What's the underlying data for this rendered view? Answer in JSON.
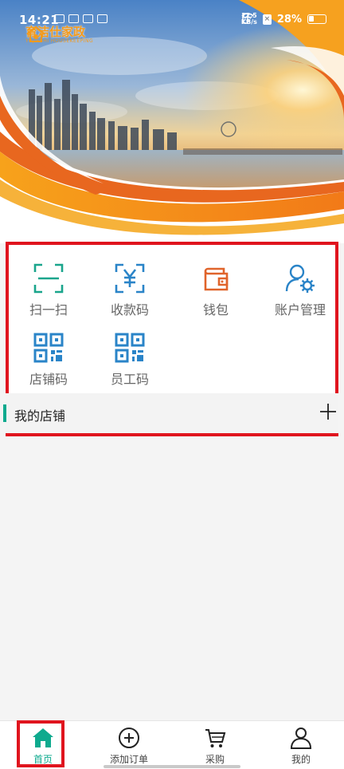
{
  "status_bar": {
    "time": "14:21",
    "net_speed_value": "12.5",
    "net_speed_unit": "KB/s",
    "battery": "28%"
  },
  "banner": {
    "logo_text": "育洁仕家政",
    "logo_sub": "YUJIESHI HOUSEKEEPING"
  },
  "quick_menu": {
    "items": [
      {
        "label": "扫一扫",
        "icon": "scan-icon",
        "color": "#1aa58c"
      },
      {
        "label": "收款码",
        "icon": "yuan-qr-icon",
        "color": "#2a84c8"
      },
      {
        "label": "钱包",
        "icon": "wallet-icon",
        "color": "#e0642b"
      },
      {
        "label": "账户管理",
        "icon": "user-settings-icon",
        "color": "#2a84c8"
      },
      {
        "label": "店铺码",
        "icon": "qr-code-icon",
        "color": "#2a84c8"
      },
      {
        "label": "员工码",
        "icon": "qr-code-icon",
        "color": "#2a84c8"
      }
    ]
  },
  "my_shop": {
    "title": "我的店铺"
  },
  "bottom_nav": {
    "items": [
      {
        "label": "首页",
        "icon": "home-icon",
        "active": true
      },
      {
        "label": "添加订单",
        "icon": "add-circle-icon"
      },
      {
        "label": "采购",
        "icon": "cart-icon"
      },
      {
        "label": "我的",
        "icon": "person-icon"
      }
    ]
  },
  "colors": {
    "accent": "#0eaa8e",
    "highlight": "#e0141e",
    "banner_orange": "#f39a1c"
  }
}
